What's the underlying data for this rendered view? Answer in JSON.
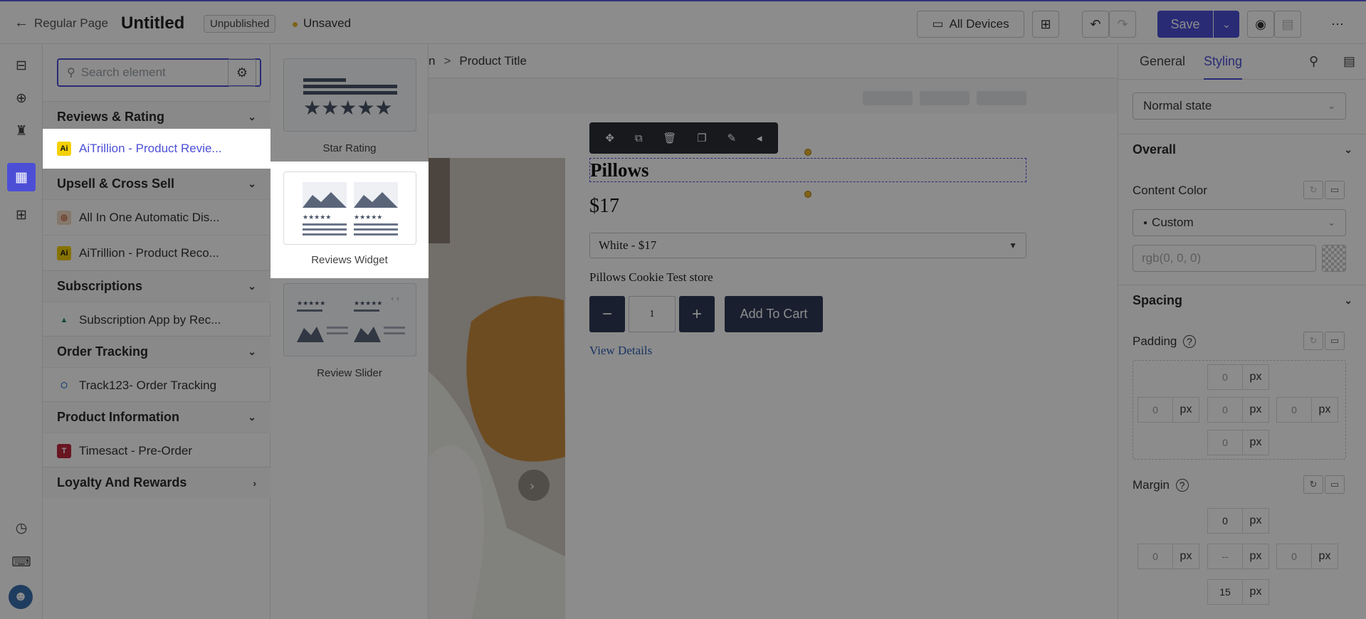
{
  "topbar": {
    "page_type": "Regular Page",
    "title": "Untitled",
    "badge": "Unpublished",
    "status": "Unsaved",
    "devices": "All Devices",
    "save": "Save"
  },
  "search": {
    "placeholder": "Search element"
  },
  "categories": {
    "reviews": "Reviews & Rating",
    "upsell": "Upsell & Cross Sell",
    "subscriptions": "Subscriptions",
    "order_tracking": "Order Tracking",
    "product_info": "Product Information",
    "loyalty": "Loyalty And Rewards"
  },
  "items": {
    "aitrillion_reviews": "AiTrillion - Product Revie...",
    "all_in_one": "All In One Automatic Dis...",
    "aitrillion_reco": "AiTrillion - Product Reco...",
    "subscription_app": "Subscription App by Rec...",
    "track123": "Track123- Order Tracking",
    "timesact": "Timesact - Pre-Order"
  },
  "widgets": {
    "star_rating": "Star Rating",
    "reviews_widget": "Reviews Widget",
    "review_slider": "Review Slider"
  },
  "canvas": {
    "breadcrumb_prev": "n",
    "breadcrumb_sep": ">",
    "breadcrumb_current": "Product Title",
    "product_title": "Pillows",
    "price": "$17",
    "variant": "White - $17",
    "store": "Pillows Cookie Test store",
    "qty": "1",
    "add_to_cart": "Add To Cart",
    "view_details": "View Details"
  },
  "inspector": {
    "tab_general": "General",
    "tab_styling": "Styling",
    "state": "Normal state",
    "overall": "Overall",
    "content_color": "Content Color",
    "color_mode": "Custom",
    "color_value": "rgb(0, 0, 0)",
    "spacing": "Spacing",
    "padding": "Padding",
    "margin": "Margin",
    "unit": "px",
    "padding_values": {
      "top": "0",
      "left": "0",
      "center": "0",
      "right": "0",
      "bottom": "0"
    },
    "margin_values": {
      "top": "0",
      "left": "0",
      "center": "--",
      "right": "0",
      "bottom": "15"
    }
  },
  "colors": {
    "accent": "#4c4fd6",
    "button_dark": "#2e3a57",
    "link": "#2f5fb3"
  }
}
